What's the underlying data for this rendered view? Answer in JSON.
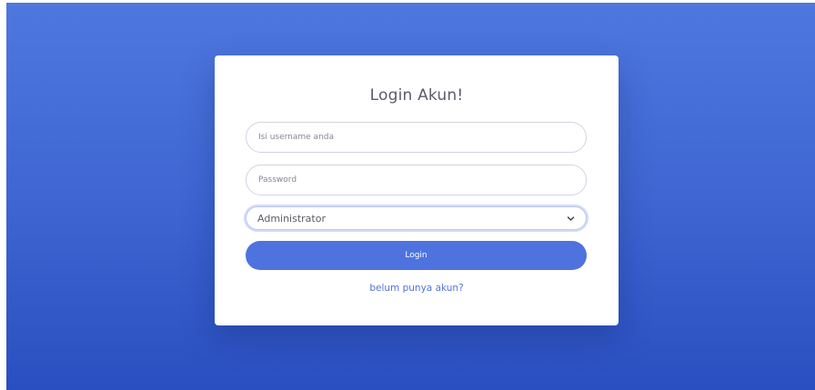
{
  "login": {
    "title": "Login Akun!",
    "username_placeholder": "Isi username anda",
    "password_placeholder": "Password",
    "role_selected": "Administrator",
    "submit_label": "Login",
    "register_link": "belum punya akun?"
  },
  "colors": {
    "background_top": "#4e78de",
    "background_bottom": "#2a4fc0",
    "button": "#4e73df",
    "link": "#4e73df",
    "card": "#ffffff"
  }
}
